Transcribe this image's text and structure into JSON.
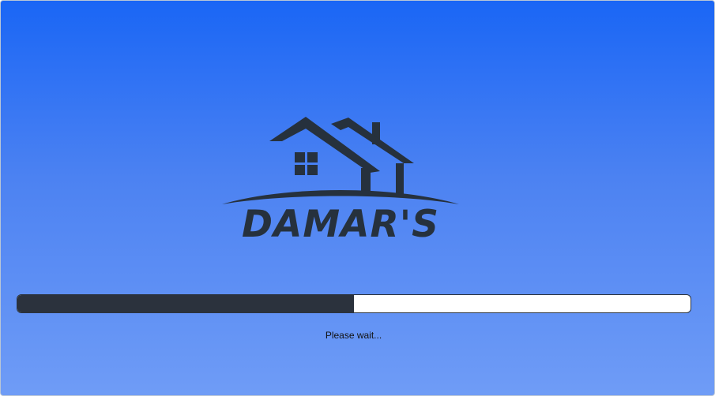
{
  "splash": {
    "brand_name": "DAMAR'S",
    "logo_icon": "house-icon",
    "progress": 0.5,
    "status_text": "Please wait...",
    "colors": {
      "gradient_top": "#1a66f5",
      "gradient_bottom": "#6f9cf6",
      "logo": "#26313d",
      "progress_fill": "#2b323d",
      "progress_track": "#ffffff"
    }
  }
}
